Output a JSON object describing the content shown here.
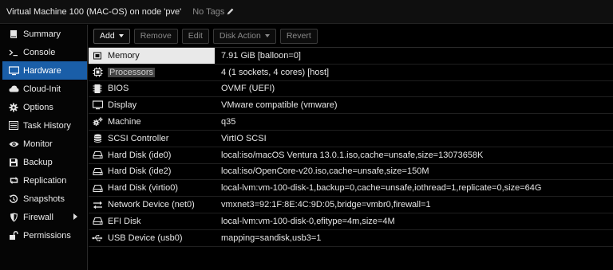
{
  "window": {
    "title": "Virtual Machine 100 (MAC-OS) on node 'pve'",
    "tags_label": "No Tags"
  },
  "sidebar": {
    "items": [
      {
        "label": "Summary",
        "icon": "book-icon"
      },
      {
        "label": "Console",
        "icon": "terminal-icon"
      },
      {
        "label": "Hardware",
        "icon": "monitor-icon",
        "active": true
      },
      {
        "label": "Cloud-Init",
        "icon": "cloud-icon"
      },
      {
        "label": "Options",
        "icon": "gear-icon"
      },
      {
        "label": "Task History",
        "icon": "list-icon"
      },
      {
        "label": "Monitor",
        "icon": "eye-icon"
      },
      {
        "label": "Backup",
        "icon": "floppy-icon"
      },
      {
        "label": "Replication",
        "icon": "retweet-icon"
      },
      {
        "label": "Snapshots",
        "icon": "history-icon"
      },
      {
        "label": "Firewall",
        "icon": "shield-icon",
        "expandable": true
      },
      {
        "label": "Permissions",
        "icon": "unlock-icon"
      }
    ]
  },
  "toolbar": {
    "add_label": "Add",
    "remove_label": "Remove",
    "edit_label": "Edit",
    "disk_action_label": "Disk Action",
    "revert_label": "Revert"
  },
  "hardware": {
    "rows": [
      {
        "name": "Memory",
        "value": "7.91 GiB [balloon=0]",
        "icon": "memory-icon"
      },
      {
        "name": "Processors",
        "value": "4 (1 sockets, 4 cores) [host]",
        "icon": "cpu-icon"
      },
      {
        "name": "BIOS",
        "value": "OVMF (UEFI)",
        "icon": "chip-icon"
      },
      {
        "name": "Display",
        "value": "VMware compatible (vmware)",
        "icon": "desktop-icon"
      },
      {
        "name": "Machine",
        "value": "q35",
        "icon": "cogs-icon"
      },
      {
        "name": "SCSI Controller",
        "value": "VirtIO SCSI",
        "icon": "database-icon"
      },
      {
        "name": "Hard Disk (ide0)",
        "value": "local:iso/macOS Ventura 13.0.1.iso,cache=unsafe,size=13073658K",
        "icon": "hdd-icon"
      },
      {
        "name": "Hard Disk (ide2)",
        "value": "local:iso/OpenCore-v20.iso,cache=unsafe,size=150M",
        "icon": "hdd-icon"
      },
      {
        "name": "Hard Disk (virtio0)",
        "value": "local-lvm:vm-100-disk-1,backup=0,cache=unsafe,iothread=1,replicate=0,size=64G",
        "icon": "hdd-icon"
      },
      {
        "name": "Network Device (net0)",
        "value": "vmxnet3=92:1F:8E:4C:9D:05,bridge=vmbr0,firewall=1",
        "icon": "exchange-icon"
      },
      {
        "name": "EFI Disk",
        "value": "local-lvm:vm-100-disk-0,efitype=4m,size=4M",
        "icon": "hdd-icon"
      },
      {
        "name": "USB Device (usb0)",
        "value": "mapping=sandisk,usb3=1",
        "icon": "usb-icon"
      }
    ]
  }
}
